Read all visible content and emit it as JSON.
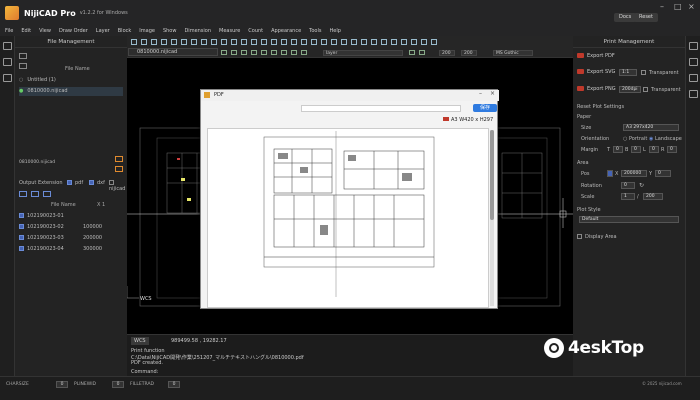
{
  "app": {
    "name": "NijiCAD Pro",
    "version": "v1.2.2 for Windows",
    "buttons": [
      "Docs",
      "Reset"
    ]
  },
  "menu": [
    "File",
    "Edit",
    "View",
    "Draw Order",
    "Layer",
    "Block",
    "Image",
    "Show",
    "Dimension",
    "Measure",
    "Count",
    "Appearance",
    "Tools",
    "Help"
  ],
  "left_panel": {
    "title": "File Management",
    "col_header": "File Name",
    "files": [
      "Untitled (1)",
      "0810000.nijicad"
    ],
    "selected_file": "0810000.nijicad",
    "output_label": "Output Extension",
    "ext_options": [
      {
        "label": "pdf",
        "checked": true
      },
      {
        "label": "dxf",
        "checked": true
      },
      {
        "label": "nijicad",
        "checked": false
      }
    ],
    "table_headers": [
      "File Name",
      "X 1"
    ],
    "table_rows": [
      {
        "name": "102190023-01",
        "value": ""
      },
      {
        "name": "102190023-02",
        "value": "100000"
      },
      {
        "name": "102190023-03",
        "value": "200000"
      },
      {
        "name": "102190023-04",
        "value": "300000"
      }
    ]
  },
  "toolbar": {
    "layer_select": "layer",
    "size1": "200",
    "size2": "200",
    "font": "MS Gothic"
  },
  "tab": {
    "label": "0810000.nijicad"
  },
  "canvas": {
    "wcs": "WCS"
  },
  "pdf_window": {
    "title": "PDF",
    "save_label": "保存",
    "page_size": "A3 W420 x H297"
  },
  "command": {
    "wcs": "WCS",
    "coords": "989499.58 , 19282.17",
    "lines": [
      "Print function",
      "C:\\Data\\NijiCAD開発\\作業\\251207_マルチテキストハングル\\0810000.pdf",
      "PDF created."
    ],
    "prompt": "Command:"
  },
  "right_panel": {
    "title": "Print Management",
    "export_pdf": "Export PDF",
    "export_svg": "Export SVG",
    "svg_scale": "1:1",
    "transparent": "Transparent",
    "export_png": "Export PNG",
    "png_dpi": "200dpi",
    "reset_settings": "Reset Plot Settings",
    "paper": "Paper",
    "size_label": "Size",
    "size_value": "A3 297x420",
    "orientation_label": "Orientation",
    "portrait": "Portrait",
    "landscape": "Landscape",
    "margin_label": "Margin",
    "margins": [
      "T",
      "0",
      "B",
      "0",
      "L",
      "0",
      "R",
      "0"
    ],
    "area": "Area",
    "pos_label": "Pos",
    "pos_x": "200000",
    "pos_y": "0",
    "rotation_label": "Rotation",
    "rotation_value": "0",
    "scale_label": "Scale",
    "scale_a": "1",
    "scale_b": "200",
    "plot_style": "Plot Style",
    "style_value": "Default",
    "display_area": "Display Area"
  },
  "statusbar": {
    "items": [
      {
        "label": "CHARSIZE",
        "value": "0"
      },
      {
        "label": "PLINEWID",
        "value": "0"
      },
      {
        "label": "FILLETRAD",
        "value": "0"
      }
    ]
  },
  "watermark": {
    "text": "4eskTop"
  },
  "copyright": "© 2025 nijicad.com"
}
